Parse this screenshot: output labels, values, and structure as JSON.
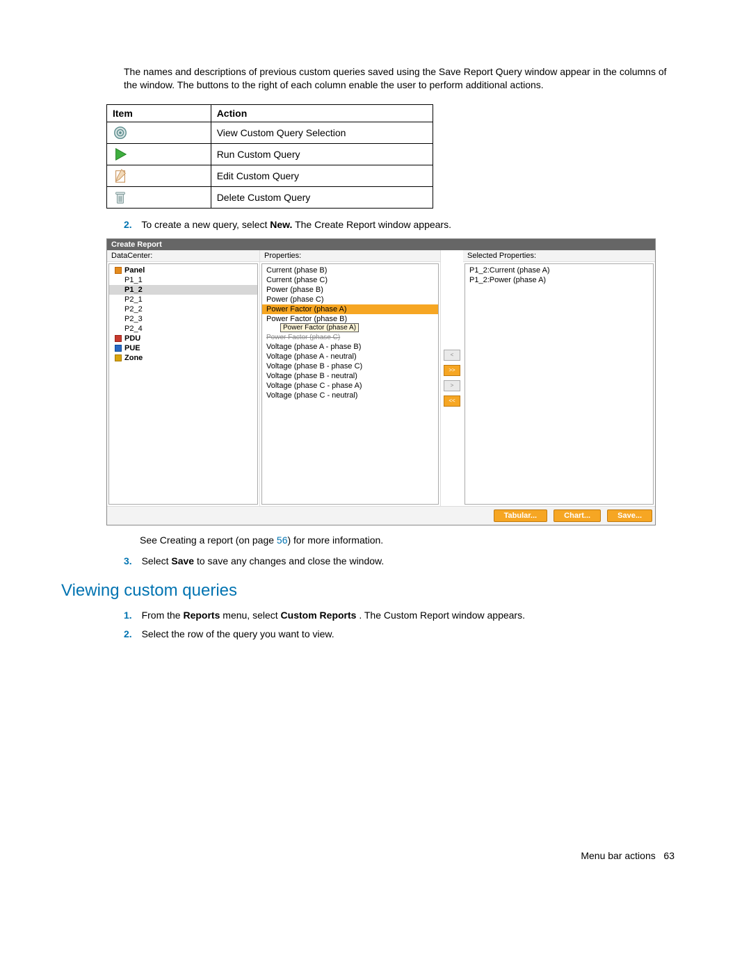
{
  "intro": "The names and descriptions of previous custom queries saved using the Save Report Query window appear in the columns of the window. The buttons to the right of each column enable the user to perform additional actions.",
  "table": {
    "headers": {
      "item": "Item",
      "action": "Action"
    },
    "rows": [
      {
        "icon": "view-icon",
        "action": "View Custom Query Selection"
      },
      {
        "icon": "run-icon",
        "action": "Run Custom Query"
      },
      {
        "icon": "edit-icon",
        "action": "Edit Custom Query"
      },
      {
        "icon": "delete-icon",
        "action": "Delete Custom Query"
      }
    ]
  },
  "step2": {
    "num": "2.",
    "text_a": "To create a new query, select ",
    "bold": "New.",
    "text_b": " The Create Report window appears."
  },
  "cr": {
    "title": "Create Report",
    "cols": {
      "datacenter": "DataCenter:",
      "properties": "Properties:",
      "selected": "Selected Properties:"
    },
    "tree": [
      {
        "label": "Panel",
        "icon": "ic-orange"
      },
      {
        "label": "P1_1",
        "indent": true
      },
      {
        "label": "P1_2",
        "indent": true,
        "selected": true
      },
      {
        "label": "P2_1",
        "indent": true
      },
      {
        "label": "P2_2",
        "indent": true
      },
      {
        "label": "P2_3",
        "indent": true
      },
      {
        "label": "P2_4",
        "indent": true
      },
      {
        "label": "PDU",
        "icon": "ic-red"
      },
      {
        "label": "PUE",
        "icon": "ic-blue"
      },
      {
        "label": "Zone",
        "icon": "ic-yellow"
      }
    ],
    "props": [
      "Current (phase B)",
      "Current (phase C)",
      "Power (phase B)",
      "Power (phase C)",
      {
        "label": "Power Factor (phase A)",
        "selected": true
      },
      "Power Factor (phase B)",
      "Power Factor (phase C)",
      "Voltage (phase A - phase B)",
      "Voltage (phase A - neutral)",
      "Voltage (phase B - phase C)",
      "Voltage (phase B - neutral)",
      "Voltage (phase C - phase A)",
      "Voltage (phase C - neutral)"
    ],
    "tooltip": "Power Factor (phase A)",
    "selected_props": [
      "P1_2:Current (phase A)",
      "P1_2:Power (phase A)"
    ],
    "mid_btns": {
      "lt": "<",
      "gt": ">>",
      "gtlbl": ">",
      "ltlt": "<<"
    },
    "footer_btns": {
      "tabular": "Tabular...",
      "chart": "Chart...",
      "save": "Save..."
    }
  },
  "see_line": {
    "a": "See Creating a report (on page ",
    "page": "56",
    "b": ") for more information."
  },
  "step3": {
    "num": "3.",
    "a": "Select ",
    "bold": "Save",
    "b": " to save any changes and close the window."
  },
  "heading": "Viewing custom queries",
  "vq_step1": {
    "num": "1.",
    "a": "From the ",
    "bold1": "Reports",
    "b": " menu, select ",
    "bold2": "Custom Reports",
    "c": ". The Custom Report window appears."
  },
  "vq_step2": {
    "num": "2.",
    "text": "Select the row of the query you want to view."
  },
  "footer": {
    "label": "Menu bar actions",
    "page": "63"
  }
}
